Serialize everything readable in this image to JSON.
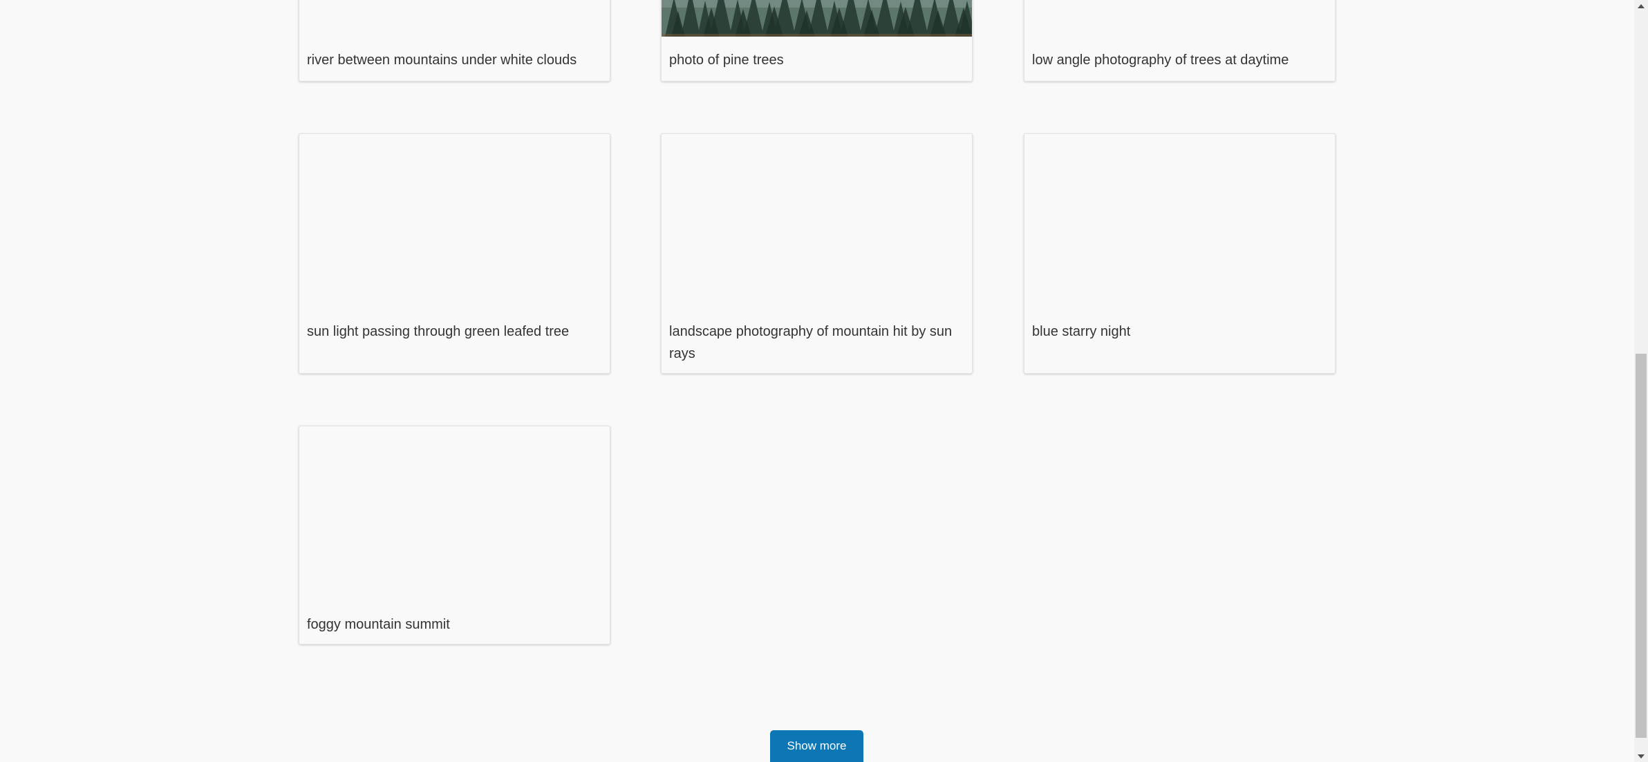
{
  "gallery": {
    "cards": [
      {
        "caption": "river between mountains under white clouds"
      },
      {
        "caption": "photo of pine trees"
      },
      {
        "caption": "low angle photography of trees at daytime"
      },
      {
        "caption": "sun light passing through green leafed tree"
      },
      {
        "caption": "landscape photography of mountain hit by sun rays"
      },
      {
        "caption": "blue starry night"
      },
      {
        "caption": "foggy mountain summit"
      }
    ]
  },
  "footer": {
    "show_more_label": "Show more"
  },
  "colors": {
    "page_background": "#f9f9f9",
    "button_background": "#0d77b6",
    "caption_text": "#333333"
  },
  "icons": {
    "scroll_up": "triangle-up-icon",
    "scroll_down": "triangle-down-icon"
  }
}
